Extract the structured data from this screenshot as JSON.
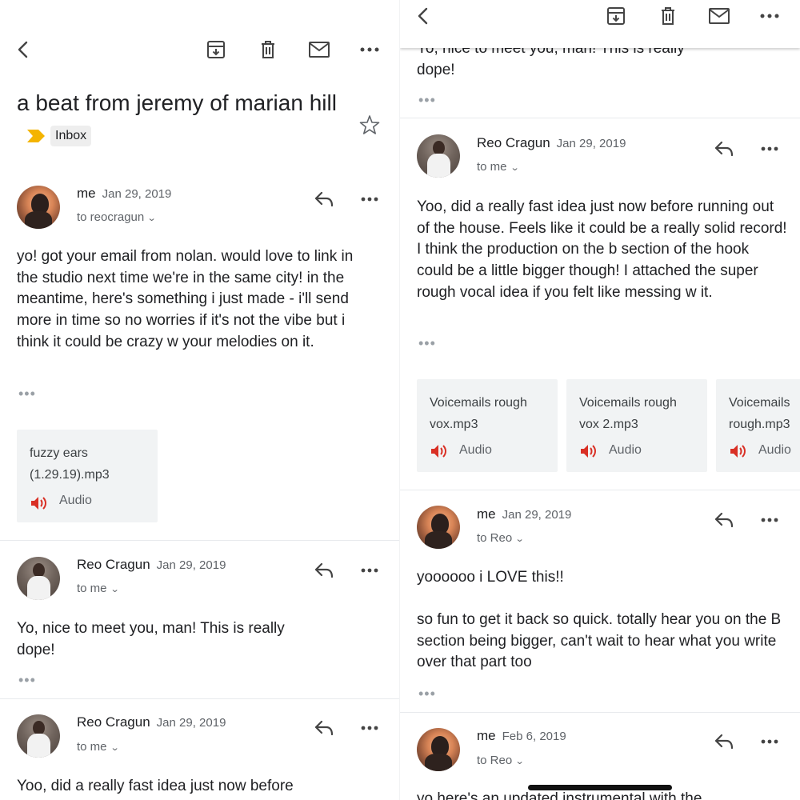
{
  "thread": {
    "subject": "a beat from jeremy of marian hill",
    "label": "Inbox",
    "label_color": "#f4b400"
  },
  "toolbar": {
    "icons": [
      "back-icon",
      "archive-icon",
      "delete-icon",
      "mark-unread-icon",
      "more-icon"
    ]
  },
  "messages": [
    {
      "sender": "me",
      "date": "Jan 29, 2019",
      "recipient": "to reocragun",
      "body": "yo! got your email from nolan. would love to link in the studio next time we're in the same city! in the meantime, here's something i just made - i'll send more in time so no worries if it's not the vibe but i think it could be crazy w your melodies on it.",
      "attachments": [
        {
          "name_line1": "fuzzy ears",
          "name_line2": "(1.29.19).mp3",
          "type": "Audio"
        }
      ]
    },
    {
      "sender": "Reo Cragun",
      "date": "Jan 29, 2019",
      "recipient": "to me",
      "body_line1": "Yo, nice to meet you, man! This is really",
      "body_line2": "dope!"
    },
    {
      "sender": "Reo Cragun",
      "date": "Jan 29, 2019",
      "recipient": "to me",
      "body": "Yoo, did a really fast idea just now before running out of the house. Feels like it could be a really solid record! I think the production on the b section of the hook could be a little bigger though! I attached the super rough vocal idea if you felt like messing w it.",
      "body_preview": "Yoo, did a really fast idea just now before",
      "attachments": [
        {
          "name_line1": "Voicemails rough",
          "name_line2": "vox.mp3",
          "type": "Audio"
        },
        {
          "name_line1": "Voicemails rough",
          "name_line2": "vox 2.mp3",
          "type": "Audio"
        },
        {
          "name_line1": "Voicemails",
          "name_line2": "rough.mp3",
          "type": "Audio"
        }
      ]
    },
    {
      "sender": "me",
      "date": "Jan 29, 2019",
      "recipient": "to Reo",
      "body_line1": "yoooooo i LOVE this!!",
      "body_para2": "so fun to get it back so quick. totally hear you on the B section being bigger, can't wait to hear what you write over that part too"
    },
    {
      "sender": "me",
      "date": "Feb 6, 2019",
      "recipient": "to Reo",
      "body_preview": "yo here's an updated instrumental with the"
    }
  ],
  "colors": {
    "accent_speaker": "#d93025",
    "text_primary": "#202124",
    "text_secondary": "#5f6368"
  }
}
